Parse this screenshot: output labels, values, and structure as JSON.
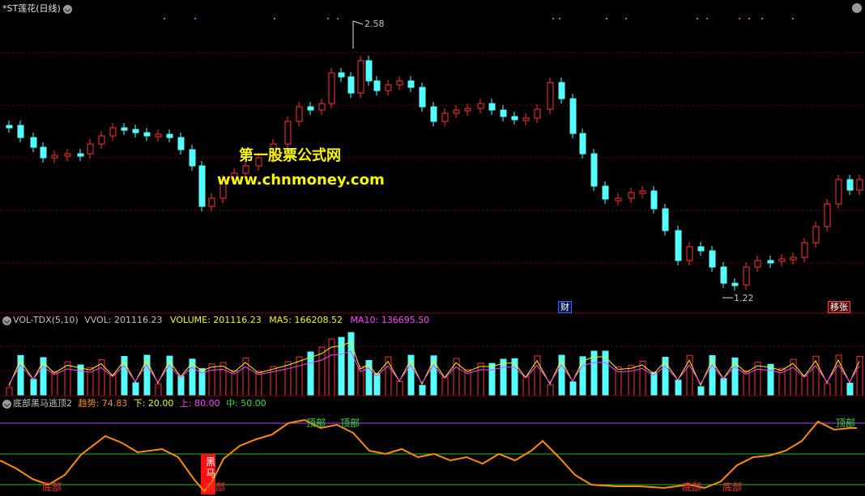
{
  "main_pane": {
    "title": "*ST莲花(日线)",
    "high_label": "2.58",
    "low_label": "1.22",
    "event_tag_1": "财",
    "event_tag_2": "移张",
    "watermark_cn": "第一股票公式网",
    "watermark_url": "www.chnmoney.com",
    "colors": {
      "up": "#ff3232",
      "down": "#54ffff",
      "grid": "#7a0000",
      "marker": "#cc44cc"
    }
  },
  "volume_pane": {
    "title": "VOL-TDX(5,10)",
    "vvol_label": "VVOL: 201116.23",
    "volume_label": "VOLUME: 201116.23",
    "ma5_label": "MA5: 166208.52",
    "ma10_label": "MA10: 136695.50",
    "colors": {
      "volume": "#f8f800",
      "ma5": "#f8f800",
      "ma10": "#ff40ff"
    }
  },
  "indicator_pane": {
    "title": "底部黑马逃顶2",
    "trend_label": "趋势: 74.83",
    "lower_label": "下: 20.00",
    "upper_label": "上: 80.00",
    "mid_label": "中: 50.00",
    "signal_top": "顶部",
    "signal_bottom": "底部",
    "signal_darkhorse": "黑马",
    "colors": {
      "trend": "#ff8c00",
      "upper": "#b040ff",
      "mid": "#20c020",
      "lower": "#20c020"
    }
  }
}
